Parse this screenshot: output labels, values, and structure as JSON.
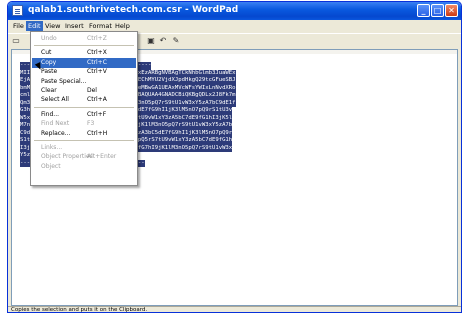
{
  "window": {
    "title": "qalab1.southrivetech.com.csr - WordPad",
    "controls": {
      "minimize": "_",
      "maximize": "□",
      "close": "✕"
    }
  },
  "menubar": {
    "items": [
      "File",
      "Edit",
      "View",
      "Insert",
      "Format",
      "Help"
    ],
    "active": "Edit"
  },
  "edit_menu": [
    {
      "label": "Undo",
      "shortcut": "Ctrl+Z",
      "enabled": false
    },
    {
      "separator": true
    },
    {
      "label": "Cut",
      "shortcut": "Ctrl+X",
      "enabled": true
    },
    {
      "label": "Copy",
      "shortcut": "Ctrl+C",
      "enabled": true,
      "highlighted": true
    },
    {
      "label": "Paste",
      "shortcut": "Ctrl+V",
      "enabled": true
    },
    {
      "label": "Paste Special...",
      "shortcut": "",
      "enabled": true
    },
    {
      "label": "Clear",
      "shortcut": "Del",
      "enabled": true
    },
    {
      "label": "Select All",
      "shortcut": "Ctrl+A",
      "enabled": true
    },
    {
      "separator": true
    },
    {
      "label": "Find...",
      "shortcut": "Ctrl+F",
      "enabled": true
    },
    {
      "label": "Find Next",
      "shortcut": "F3",
      "enabled": false
    },
    {
      "label": "Replace...",
      "shortcut": "Ctrl+H",
      "enabled": true
    },
    {
      "separator": true
    },
    {
      "label": "Links...",
      "shortcut": "",
      "enabled": false
    },
    {
      "label": "Object Properties",
      "shortcut": "Alt+Enter",
      "enabled": false
    },
    {
      "label": "Object",
      "shortcut": "",
      "enabled": false
    }
  ],
  "document": {
    "lines": [
      "-----BEGIN NEW CERTIFICATE REQUEST-----",
      "MIIDOzCCAqQCAQAwcDELMAkGA1UEBhMCVVMxEzARBgNVBAgTCkNhbGlmb3JuaWEx",
      "EjAQBgNVBAcTCVN1bm55dmFsZTEhMB8GA1UEChMYU2VjdXJpdHkgQ29tcGFueSBJ",
      "bmMxFjAUBgNVBAsTDVNlY3VyaXR5IExhYjEeMBwGA1UEAxMVcWFsYWIxLnNvdXRo",
      "cml2ZXRlY2guY29tMIGfMA0GCSqGSIb3DQEBAQUAA4GNADCBiQKBgQDLx2J8Fk7m",
      "Qm3vN1pR8sT4uW6yZ0bC2dE5fG7hI9jK1lM3nO5pQ7rS9tU1vW3xY5zA7bC9dE1f",
      "G3hI5jK7lM9nO1pQ3rS5tU7vW9xY1zA3bC5dE7fG9hI1jK3lM5nO7pQ9rS1tU3v",
      "W5xY7zA9bC1dE3fG5hI7jK9lM1nO3pQ5rS7tU9vW1xY3zA5bC7dE9fG1hI3jK5l",
      "M7nO9pQ1rS3tU5vW7xY9zA1bC3dE5fG7hI9jK1lM3nO5pQ7rS9tU1vW3xY5zA7b",
      "C9dE1fG3hI5jK7lM9nO1pQ3rS5tU7vW9xY1zA3bC5dE7fG9hI1jK3lM5nO7pQ9r",
      "S1tU3vW5xY7zA9bC1dE3fG5hI7jK9lM1nO3pQ5rS7tU9vW1xY3zA5bC7dE9fG1h",
      "I3jK5lM7nO9pQ1rS3tU5vW7xY9zA1bC3dE5fG7hI9jK1lM3nO5pQ7rS9tU1vW3x",
      "Y5zA7bC9dE1fG3hI5jK7lM9nO1pQ3rS5==",
      "-----END NEW CERTIFICATE REQUEST-----"
    ]
  },
  "statusbar": {
    "text": "Copies the selection and puts it on the Clipboard."
  },
  "toolbar": {
    "icons": [
      "new-icon",
      "print-preview-icon",
      "undo-icon",
      "insert-object-icon"
    ]
  }
}
